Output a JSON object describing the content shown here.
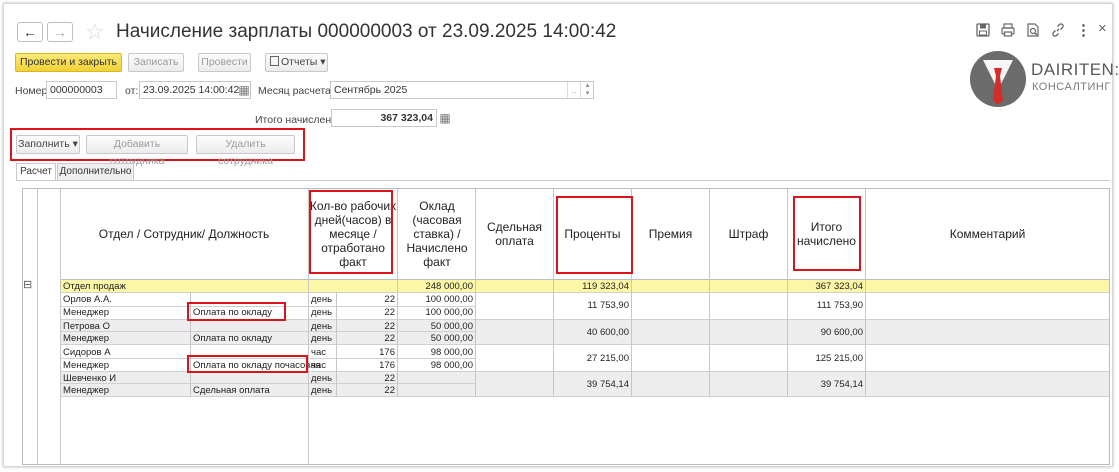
{
  "window": {
    "title": "Начисление зарплаты 000000003 от 23.09.2025 14:00:42"
  },
  "nav": {
    "back": "←",
    "forward": "→"
  },
  "toolbar": {
    "post_close": "Провести и закрыть",
    "save": "Записать",
    "post": "Провести",
    "reports": "Отчеты",
    "reports_arrow": "▾"
  },
  "form": {
    "number_label": "Номер:",
    "number_value": "000000003",
    "date_label": "от:",
    "date_value": "23.09.2025 14:00:42",
    "month_label": "Месяц расчета:",
    "month_value": "Сентябрь 2025",
    "total_label": "Итого начислено:",
    "total_value": "367 323,04"
  },
  "table_toolbar": {
    "fill": "Заполнить",
    "fill_arrow": "▾",
    "add_employee": "Добавить сотрудника",
    "remove_employee": "Удалить сотрудника"
  },
  "tabs": [
    {
      "label": "Расчет"
    },
    {
      "label": "Дополнительно"
    }
  ],
  "logo": {
    "line1": "DAIRITEN:",
    "line2": "КОНСАЛТИНГ"
  },
  "table": {
    "headers": {
      "department": "Отдел / Сотрудник/ Должность",
      "days": "Кол-во рабочих дней(часов) в месяце /отработано факт",
      "salary": "Оклад (часовая ставка)  / Начислено факт",
      "piecework": "Сдельная оплата",
      "percent": "Проценты",
      "bonus": "Премия",
      "fine": "Штраф",
      "total": "Итого начислено",
      "comment": "Комментарий"
    },
    "group": {
      "name": "Отдел продаж",
      "salary": "248 000,00",
      "percent": "119 323,04",
      "total": "367 323,04",
      "collapse": "⊟"
    },
    "employees": [
      {
        "name": "Орлов А.А.",
        "position": "Менеджер",
        "pay_type": "Оплата по окладу",
        "unit1": "день",
        "days1": "22",
        "salary1": "100 000,00",
        "unit2": "день",
        "days2": "22",
        "salary2": "100 000,00",
        "percent": "11 753,90",
        "total": "111 753,90"
      },
      {
        "name": "Петрова О",
        "position": "Менеджер",
        "pay_type": "Оплата по окладу",
        "unit1": "день",
        "days1": "22",
        "salary1": "50 000,00",
        "unit2": "день",
        "days2": "22",
        "salary2": "50 000,00",
        "percent": "40 600,00",
        "total": "90 600,00"
      },
      {
        "name": "Сидоров А",
        "position": "Менеджер",
        "pay_type": "Оплата по окладу почасовая",
        "unit1": "час",
        "days1": "176",
        "salary1": "98 000,00",
        "unit2": "час",
        "days2": "176",
        "salary2": "98 000,00",
        "percent": "27 215,00",
        "total": "125 215,00"
      },
      {
        "name": "Шевченко И",
        "position": "Менеджер",
        "pay_type": "Сдельная оплата",
        "unit1": "день",
        "days1": "22",
        "salary1": "",
        "unit2": "день",
        "days2": "22",
        "salary2": "",
        "percent": "39 754,14",
        "total": "39 754,14"
      }
    ]
  },
  "icons": [
    "save-icon",
    "print-icon",
    "preview-icon",
    "link-icon",
    "more-icon",
    "close-icon",
    "star-icon",
    "calendar-icon"
  ]
}
